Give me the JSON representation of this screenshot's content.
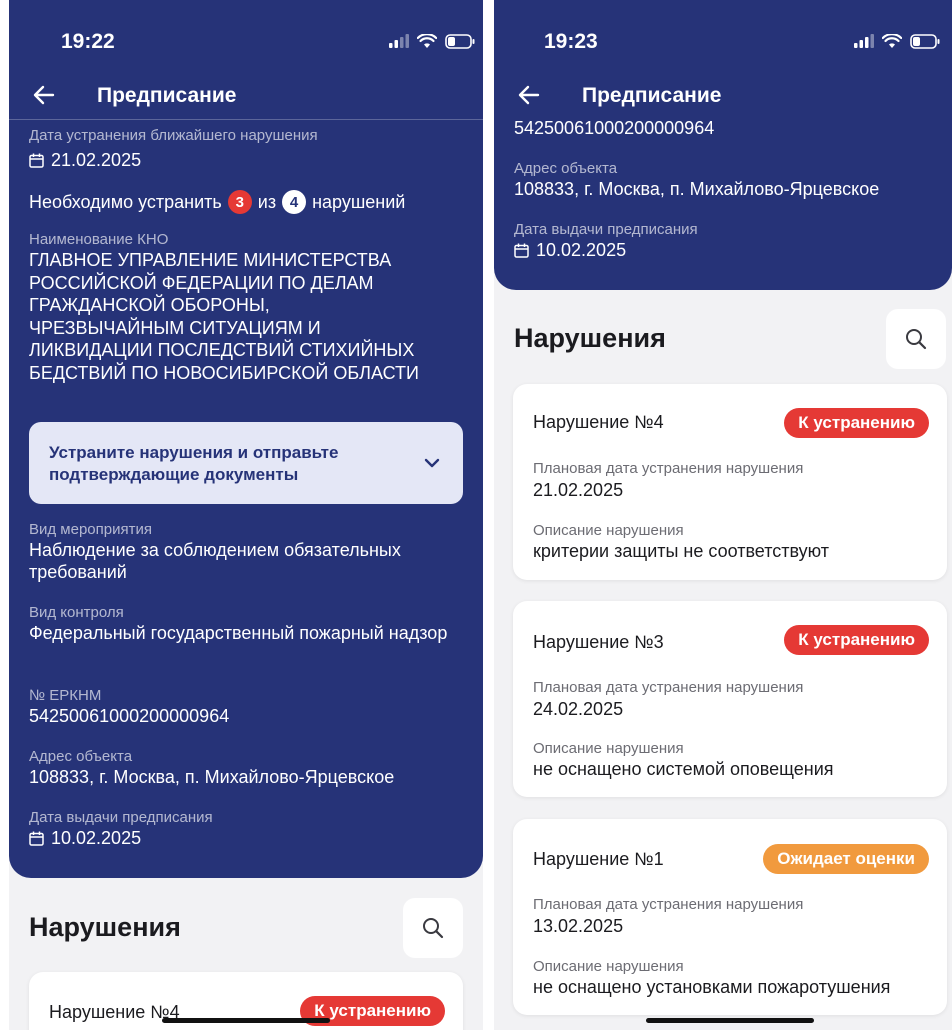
{
  "colors": {
    "header_bg": "#263378",
    "danger": "#e53935",
    "warning": "#f19a3e",
    "accent_box": "#e4e7f6"
  },
  "left": {
    "status_time": "19:22",
    "nav_title": "Предписание",
    "nearest_fix_label": "Дата устранения ближайшего нарушения",
    "nearest_fix_date": "21.02.2025",
    "count_prefix": "Необходимо устранить",
    "count_remaining": "3",
    "count_middle": "из",
    "count_total": "4",
    "count_suffix": "нарушений",
    "kno_label": "Наименование КНО",
    "kno_value": "ГЛАВНОЕ УПРАВЛЕНИЕ МИНИСТЕРСТВА РОССИЙСКОЙ ФЕДЕРАЦИИ ПО ДЕЛАМ ГРАЖДАНСКОЙ ОБОРОНЫ, ЧРЕЗВЫЧАЙНЫМ СИТУАЦИЯМ И ЛИКВИДАЦИИ ПОСЛЕДСТВИЙ СТИХИЙНЫХ БЕДСТВИЙ ПО НОВОСИБИРСКОЙ ОБЛАСТИ",
    "action_box_text": "Устраните нарушения и отправьте подтверждающие документы",
    "event_type_label": "Вид мероприятия",
    "event_type_value": "Наблюдение за соблюдением обязательных требований",
    "control_type_label": "Вид контроля",
    "control_type_value": "Федеральный государственный пожарный надзор",
    "erknm_label": "№ ЕРКНМ",
    "erknm_value": "54250061000200000964",
    "address_label": "Адрес объекта",
    "address_value": "108833, г. Москва, п. Михайлово-Ярцевское",
    "issue_date_label": "Дата выдачи предписания",
    "issue_date_value": "10.02.2025",
    "section_title": "Нарушения",
    "partial_card_title": "Нарушение №4",
    "partial_card_status": "К устранению"
  },
  "right": {
    "status_time": "19:23",
    "nav_title": "Предписание",
    "erknm_value": "54250061000200000964",
    "address_label": "Адрес объекта",
    "address_value": "108833, г. Москва, п. Михайлово-Ярцевское",
    "issue_date_label": "Дата выдачи предписания",
    "issue_date_value": "10.02.2025",
    "section_title": "Нарушения",
    "violations": [
      {
        "title": "Нарушение №4",
        "status": "К устранению",
        "plan_label": "Плановая дата устранения нарушения",
        "plan_date": "21.02.2025",
        "desc_label": "Описание нарушения",
        "desc": "критерии защиты не соответствуют"
      },
      {
        "title": "Нарушение №3",
        "status": "К устранению",
        "plan_label": "Плановая дата устранения нарушения",
        "plan_date": "24.02.2025",
        "desc_label": "Описание нарушения",
        "desc": "не оснащено системой оповещения"
      },
      {
        "title": "Нарушение №1",
        "status": "Ожидает оценки",
        "plan_label": "Плановая дата устранения нарушения",
        "plan_date": "13.02.2025",
        "desc_label": "Описание нарушения",
        "desc": "не оснащено установками пожаротушения"
      }
    ]
  }
}
